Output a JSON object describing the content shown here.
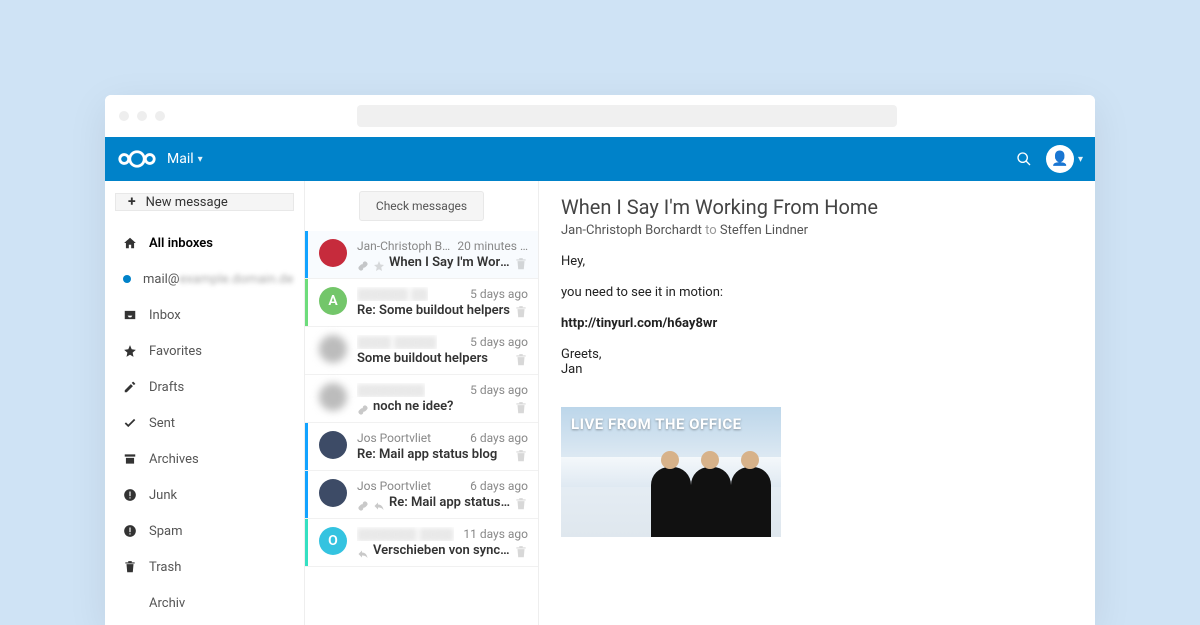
{
  "app": {
    "name": "Mail"
  },
  "sidebar": {
    "new_message": "New message",
    "items": [
      {
        "label": "All inboxes",
        "icon": "home"
      },
      {
        "label_prefix": "mail@",
        "label_rest": "example.domain.de",
        "icon": "blue-dot",
        "blurred": true
      },
      {
        "label": "Inbox",
        "icon": "inbox"
      },
      {
        "label": "Favorites",
        "icon": "star"
      },
      {
        "label": "Drafts",
        "icon": "pencil"
      },
      {
        "label": "Sent",
        "icon": "check"
      },
      {
        "label": "Archives",
        "icon": "archive"
      },
      {
        "label": "Junk",
        "icon": "bang"
      },
      {
        "label": "Spam",
        "icon": "bang"
      },
      {
        "label": "Trash",
        "icon": "trash"
      },
      {
        "label": "Archiv",
        "icon": ""
      }
    ]
  },
  "list": {
    "check_button": "Check messages",
    "messages": [
      {
        "sender": "Jan-Christoph Bor…",
        "time": "20 minutes …",
        "subject": "When I Say I'm Working Fro…",
        "accent": "#12a3ff",
        "avatar_bg": "#c62b3c",
        "avatar_text": "",
        "sel": true,
        "flags": [
          "link",
          "star"
        ]
      },
      {
        "sender": "▒▒▒▒▒▒ ▒▒",
        "time": "5 days ago",
        "subject": "Re: Some buildout helpers",
        "accent": "#6ddc7b",
        "avatar_bg": "#73c66a",
        "avatar_text": "A",
        "sel": false,
        "blur_sender": true
      },
      {
        "sender": "▒▒▒▒ ▒▒▒▒▒",
        "time": "5 days ago",
        "subject": "Some buildout helpers",
        "accent": "",
        "avatar_bg": "#bcbcbc",
        "avatar_text": "",
        "sel": false,
        "blur_sender": true,
        "blur_avatar": true
      },
      {
        "sender": "▒▒▒▒▒▒▒▒",
        "time": "5 days ago",
        "subject": "noch ne idee?",
        "accent": "",
        "avatar_bg": "#bcbcbc",
        "avatar_text": "",
        "sel": false,
        "blur_sender": true,
        "blur_avatar": true,
        "flags": [
          "link"
        ]
      },
      {
        "sender": "Jos Poortvliet",
        "time": "6 days ago",
        "subject": "Re: Mail app status blog",
        "accent": "#12a3ff",
        "avatar_bg": "#3d4b66",
        "avatar_text": "",
        "sel": false
      },
      {
        "sender": "Jos Poortvliet",
        "time": "6 days ago",
        "subject": "Re: Mail app status blog",
        "accent": "#12a3ff",
        "avatar_bg": "#3d4b66",
        "avatar_text": "",
        "sel": false,
        "flags": [
          "link",
          "reply"
        ]
      },
      {
        "sender": "▒▒▒▒▒▒▒ ▒▒▒▒",
        "time": "11 days ago",
        "subject": "Verschieben von sync…",
        "accent": "#34e0c2",
        "avatar_bg": "#34c3e0",
        "avatar_text": "O",
        "sel": false,
        "blur_sender": true,
        "flags": [
          "reply"
        ]
      }
    ]
  },
  "reader": {
    "title": "When I Say I'm Working From Home",
    "from": "Jan-Christoph Borchardt",
    "to_word": "to",
    "to": "Steffen Lindner",
    "body_lines": [
      "Hey,",
      "you need to see it in motion:"
    ],
    "link_text": "http://tinyurl.com/h6ay8wr",
    "closing": [
      "Greets,",
      "Jan"
    ],
    "image_caption": "LIVE FROM THE OFFICE"
  }
}
